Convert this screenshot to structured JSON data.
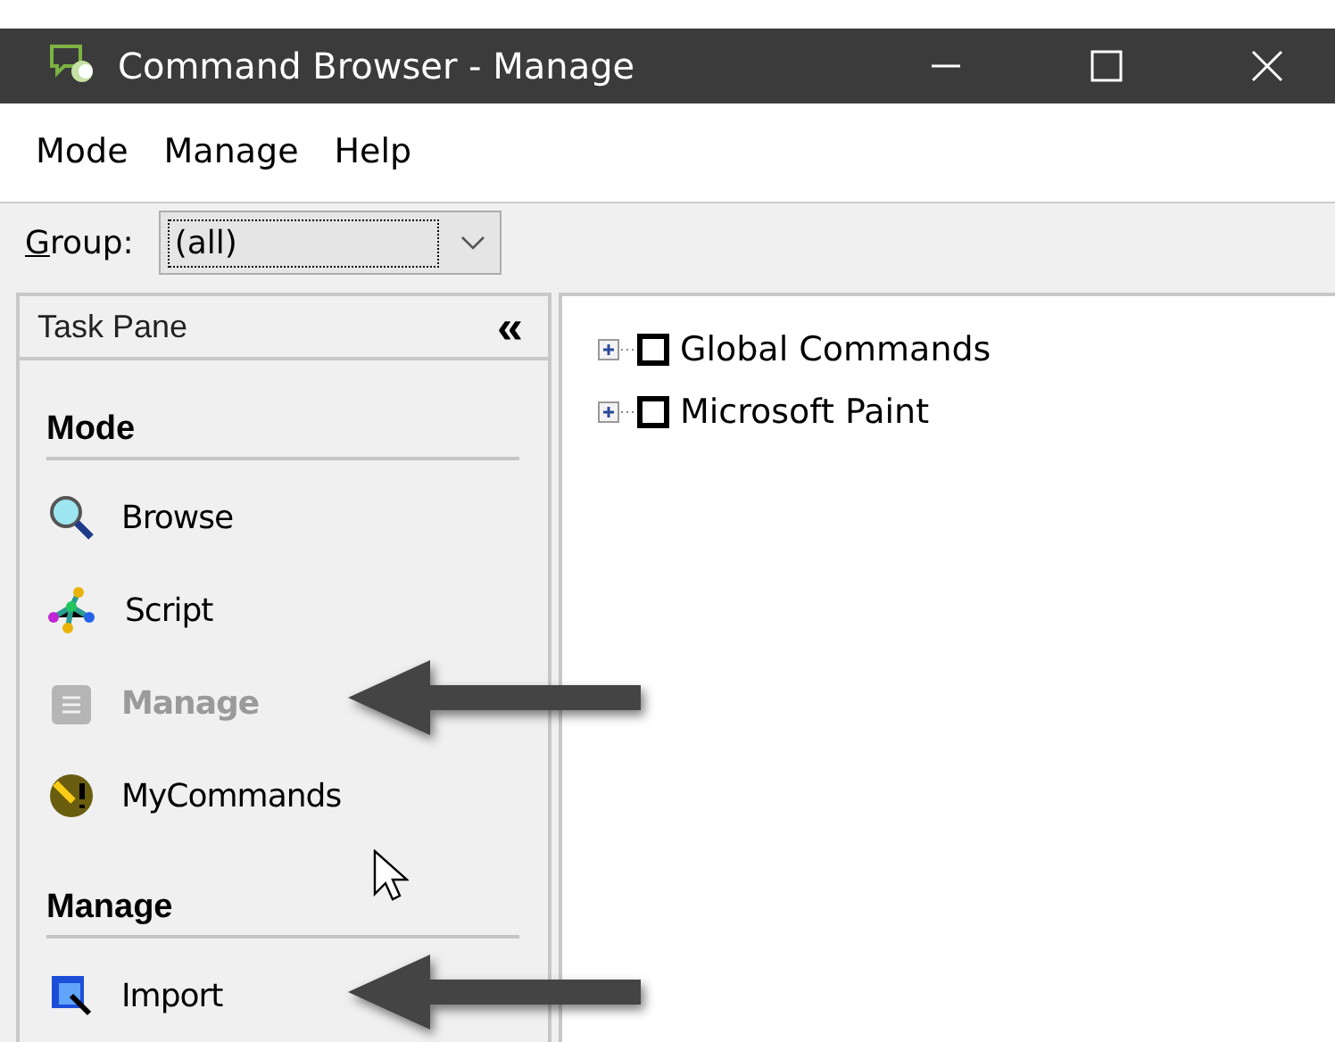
{
  "window": {
    "title": "Command Browser - Manage"
  },
  "menu": [
    "Mode",
    "Manage",
    "Help"
  ],
  "toolbar": {
    "label": "Group:",
    "combo_value": "(all)"
  },
  "task_pane": {
    "title": "Task Pane",
    "collapse": "«",
    "sections": [
      {
        "heading": "Mode",
        "items": [
          {
            "label": "Browse",
            "kind": "browse",
            "disabled": false
          },
          {
            "label": "Script",
            "kind": "script",
            "disabled": false
          },
          {
            "label": "Manage",
            "kind": "manage",
            "disabled": true
          },
          {
            "label": "MyCommands",
            "kind": "mycommands",
            "disabled": false
          }
        ]
      },
      {
        "heading": "Manage",
        "items": [
          {
            "label": "Import",
            "kind": "import",
            "disabled": false
          }
        ]
      }
    ]
  },
  "tree": [
    {
      "label": "Global Commands",
      "expanded": false,
      "checked": false
    },
    {
      "label": "Microsoft Paint",
      "expanded": false,
      "checked": false
    }
  ]
}
